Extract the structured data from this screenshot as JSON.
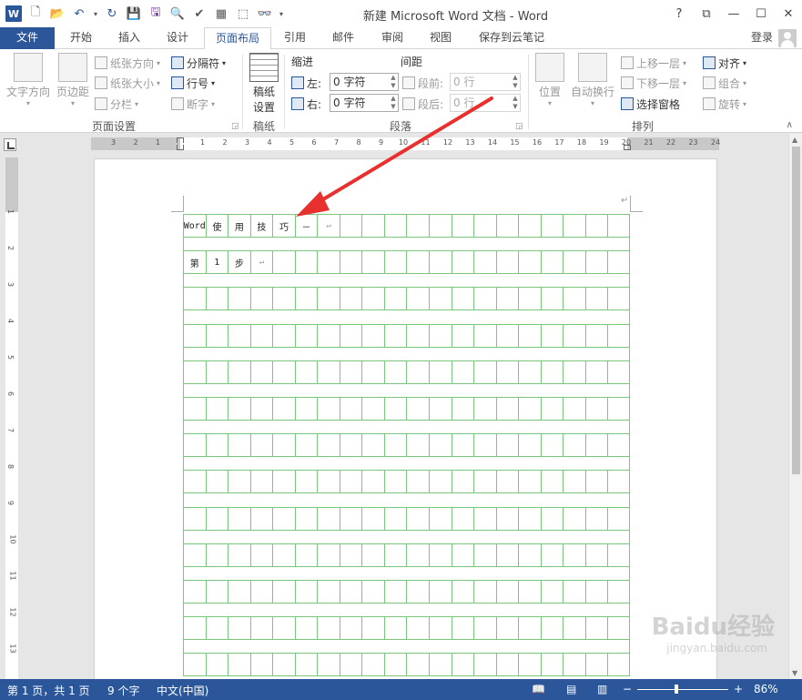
{
  "window": {
    "title": "新建 Microsoft Word 文档 - Word",
    "help": "?",
    "controls": [
      "restore-ribbon",
      "minimize",
      "maximize",
      "close"
    ]
  },
  "tabs": [
    {
      "label": "文件"
    },
    {
      "label": "开始"
    },
    {
      "label": "插入"
    },
    {
      "label": "设计"
    },
    {
      "label": "页面布局"
    },
    {
      "label": "引用"
    },
    {
      "label": "邮件"
    },
    {
      "label": "审阅"
    },
    {
      "label": "视图"
    },
    {
      "label": "保存到云笔记"
    }
  ],
  "signin": "登录",
  "ribbon": {
    "page_setup": {
      "label": "页面设置",
      "text_direction": "文字方向",
      "margins": "页边距",
      "orientation": "纸张方向",
      "size": "纸张大小",
      "columns": "分栏",
      "breaks": "分隔符",
      "line_numbers": "行号",
      "hyphenation": "断字"
    },
    "manuscript": {
      "label": "稿纸",
      "settings_line1": "稿纸",
      "settings_line2": "设置"
    },
    "paragraph": {
      "label": "段落",
      "indent_title": "缩进",
      "spacing_title": "间距",
      "left_label": "左:",
      "right_label": "右:",
      "left_value": "0 字符",
      "right_value": "0 字符",
      "before_label": "段前:",
      "after_label": "段后:",
      "before_value": "0 行",
      "after_value": "0 行"
    },
    "arrange": {
      "label": "排列",
      "position": "位置",
      "wrap_text": "自动换行",
      "bring_forward": "上移一层",
      "send_backward": "下移一层",
      "selection_pane": "选择窗格",
      "align": "对齐",
      "group": "组合",
      "rotate": "旋转"
    }
  },
  "document": {
    "grid_rows": 13,
    "grid_cols": 20,
    "lines": [
      [
        "Word",
        "使",
        "用",
        "技",
        "巧",
        "－"
      ],
      [
        "第",
        "1",
        "步"
      ]
    ],
    "paragraph_mark": "↵"
  },
  "status": {
    "page": "第 1 页，共 1 页",
    "words": "9 个字",
    "language": "中文(中国)",
    "zoom": "86%",
    "zoom_minus": "−",
    "zoom_plus": "+"
  },
  "watermark": {
    "brand": "Baidu经验",
    "url": "jingyan.baidu.com"
  },
  "colors": {
    "brand": "#2b579a",
    "grid": "#7bc67e",
    "annotation": "#e8312f"
  }
}
